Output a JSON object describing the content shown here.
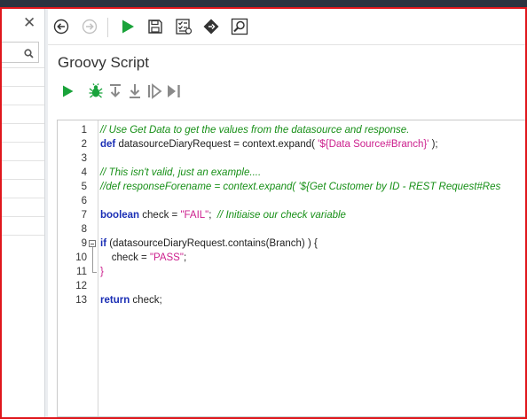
{
  "left_panel": {
    "close_glyph": "✕",
    "search": {
      "placeholder": "",
      "icon": "search-icon"
    }
  },
  "toolbar": {
    "buttons": [
      {
        "name": "back-button",
        "icon": "arrow-left-circle-icon",
        "enabled": true
      },
      {
        "name": "forward-button",
        "icon": "arrow-right-circle-icon",
        "enabled": false
      },
      {
        "name": "run-button",
        "icon": "play-icon"
      },
      {
        "name": "save-button",
        "icon": "floppy-icon"
      },
      {
        "name": "checklist-button",
        "icon": "checklist-icon"
      },
      {
        "name": "tag-button",
        "icon": "diamond-icon"
      },
      {
        "name": "inspect-button",
        "icon": "magnifier-icon"
      }
    ]
  },
  "panel": {
    "title": "Groovy Script",
    "run_toolbar": [
      "play-icon",
      "bug-icon",
      "step-over-icon",
      "step-into-icon",
      "resume-icon",
      "step-end-icon"
    ]
  },
  "editor": {
    "lines": [
      {
        "n": "1",
        "tokens": [
          {
            "t": "// Use Get Data to get the values from the datasource and response.",
            "c": "cmt"
          }
        ]
      },
      {
        "n": "2",
        "tokens": [
          {
            "t": "def",
            "c": "kw"
          },
          {
            "t": " datasourceDiaryRequest = context.expand( ",
            "c": ""
          },
          {
            "t": "'${Data Source#Branch}'",
            "c": "str"
          },
          {
            "t": " );",
            "c": ""
          }
        ]
      },
      {
        "n": "3",
        "tokens": []
      },
      {
        "n": "4",
        "tokens": [
          {
            "t": "// This isn't valid, just an example....",
            "c": "cmt"
          }
        ]
      },
      {
        "n": "5",
        "tokens": [
          {
            "t": "//def responseForename = context.expand( '${Get Customer by ID - REST Request#Res",
            "c": "cmt"
          }
        ]
      },
      {
        "n": "6",
        "tokens": []
      },
      {
        "n": "7",
        "tokens": [
          {
            "t": "boolean",
            "c": "kw"
          },
          {
            "t": " check = ",
            "c": ""
          },
          {
            "t": "\"FAIL\"",
            "c": "str"
          },
          {
            "t": ";  ",
            "c": ""
          },
          {
            "t": "// Initiaise our check variable",
            "c": "cmt"
          }
        ]
      },
      {
        "n": "8",
        "tokens": []
      },
      {
        "n": "9",
        "tokens": [
          {
            "t": "if",
            "c": "kw"
          },
          {
            "t": " (datasourceDiaryRequest.contains(Branch) ) {",
            "c": ""
          }
        ]
      },
      {
        "n": "10",
        "tokens": [
          {
            "t": "    check = ",
            "c": ""
          },
          {
            "t": "\"PASS\"",
            "c": "str"
          },
          {
            "t": ";",
            "c": ""
          }
        ]
      },
      {
        "n": "11",
        "tokens": [
          {
            "t": "}",
            "c": "str"
          }
        ]
      },
      {
        "n": "12",
        "tokens": []
      },
      {
        "n": "13",
        "tokens": [
          {
            "t": "return",
            "c": "kw"
          },
          {
            "t": " check;",
            "c": ""
          }
        ]
      }
    ]
  }
}
